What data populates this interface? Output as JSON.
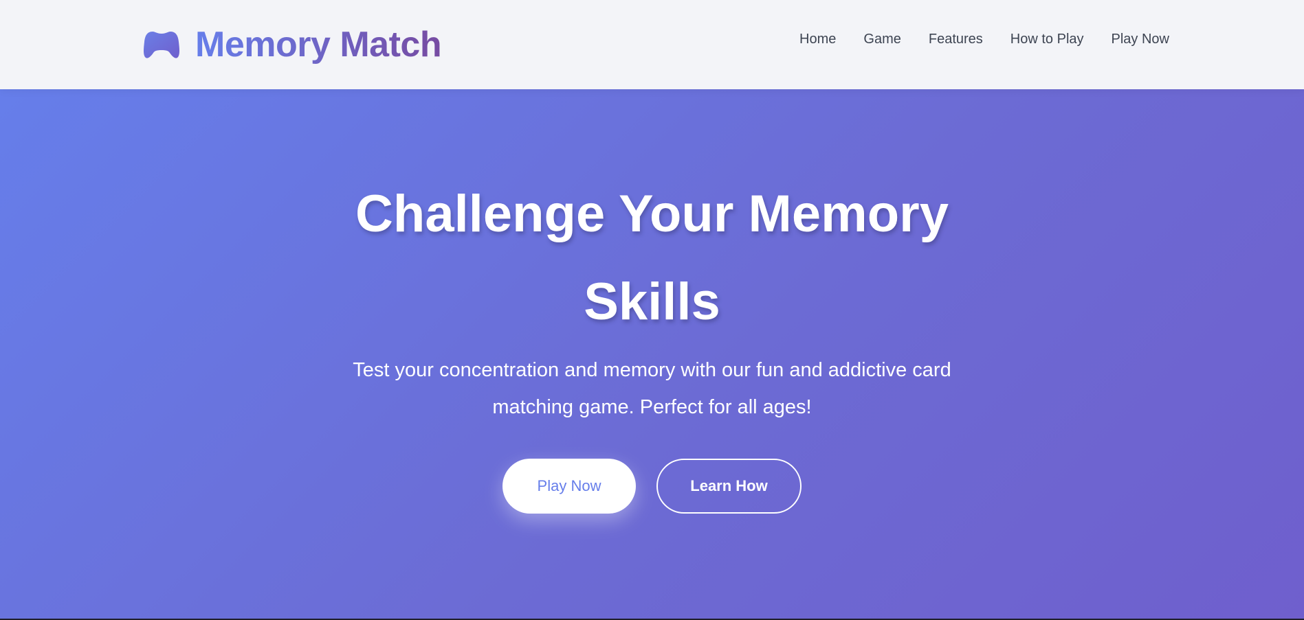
{
  "brand": {
    "name": "Memory Match",
    "icon": "gamepad-icon",
    "gradient_start": "#667eea",
    "gradient_end": "#764ba2"
  },
  "nav": {
    "items": [
      {
        "label": "Home"
      },
      {
        "label": "Game"
      },
      {
        "label": "Features"
      },
      {
        "label": "How to Play"
      },
      {
        "label": "Play Now"
      }
    ]
  },
  "hero": {
    "title": "Challenge Your Memory Skills",
    "subtitle": "Test your concentration and memory with our fun and addictive card matching game. Perfect for all ages!",
    "primary_button": "Play Now",
    "secondary_button": "Learn How",
    "background_start": "#667eea",
    "background_end": "#6f5fcd",
    "text_color": "#ffffff"
  }
}
